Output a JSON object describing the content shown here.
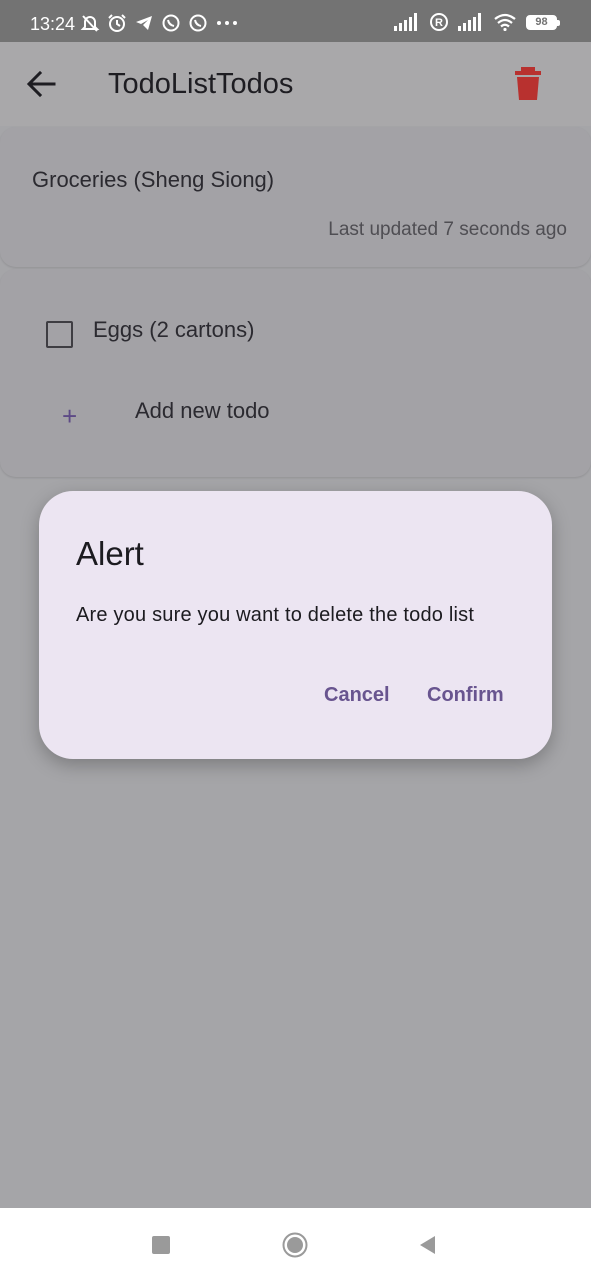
{
  "status_bar": {
    "time": "13:24",
    "battery": "98",
    "left_icons": [
      "mute-alarm-icon",
      "alarm-icon",
      "telegram-icon",
      "whatsapp-icon",
      "whatsapp-icon",
      "more-icon"
    ],
    "right_icons": [
      "signal-icon",
      "roaming-icon",
      "signal-icon",
      "wifi-icon",
      "battery-icon"
    ]
  },
  "app_bar": {
    "title": "TodoListTodos",
    "back_icon": "arrow-back-icon",
    "delete_icon": "trash-icon",
    "delete_color": "#c0392b"
  },
  "list_info": {
    "name": "Groceries (Sheng Siong)",
    "last_updated": "Last updated 7 seconds ago"
  },
  "todos": {
    "items": [
      {
        "label": "Eggs (2 cartons)",
        "checked": false
      }
    ],
    "add_label": "Add new todo",
    "add_icon": "plus-icon"
  },
  "dialog": {
    "title": "Alert",
    "message": "Are you sure you want to delete the todo list",
    "cancel_label": "Cancel",
    "confirm_label": "Confirm",
    "accent": "#68548f"
  },
  "nav_bar": {
    "icons": [
      "recents-square-icon",
      "home-circle-icon",
      "back-triangle-icon"
    ]
  }
}
